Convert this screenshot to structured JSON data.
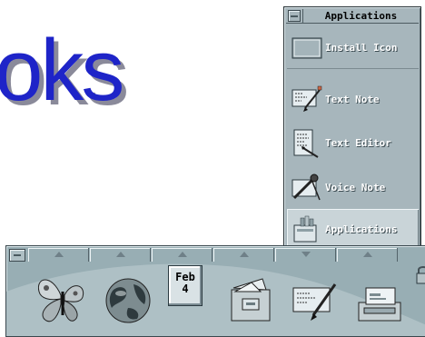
{
  "background": {
    "heading_fragment": "oks"
  },
  "subpanel": {
    "title": "Applications",
    "items": [
      {
        "label": "Install Icon",
        "icon": "install-icon"
      },
      {
        "label": "Text Note",
        "icon": "text-note-icon"
      },
      {
        "label": "Text Editor",
        "icon": "text-editor-icon"
      },
      {
        "label": "Voice Note",
        "icon": "voice-note-icon"
      },
      {
        "label": "Applications",
        "icon": "applications-icon"
      }
    ]
  },
  "front_panel": {
    "date": {
      "month": "Feb",
      "day": "4"
    },
    "icons": [
      "butterfly-icon",
      "globe-icon",
      "calendar-icon",
      "file-manager-icon",
      "text-note-icon",
      "mail-tray-icon"
    ],
    "arrow_directions": [
      "up",
      "up",
      "up",
      "up",
      "down",
      "up"
    ]
  },
  "colors": {
    "panel": "#98aeb4",
    "subpanel": "#a7b6bc",
    "heading": "#1e24c8",
    "selected": "#c9d4d8"
  }
}
